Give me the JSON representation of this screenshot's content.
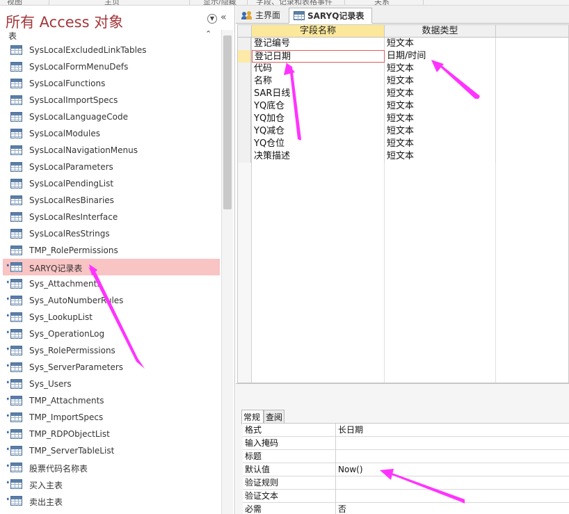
{
  "ribbon": {
    "items": [
      "视图",
      "主页",
      "显示/隐藏",
      "字段、记录和表格事件",
      "关系"
    ]
  },
  "nav_pane": {
    "title": "所有 Access 对象",
    "group_label": "表",
    "items": [
      {
        "label": "SysLocalExcludedLinkTables",
        "linked": false,
        "selected": false
      },
      {
        "label": "SysLocalFormMenuDefs",
        "linked": false,
        "selected": false
      },
      {
        "label": "SysLocalFunctions",
        "linked": false,
        "selected": false
      },
      {
        "label": "SysLocalImportSpecs",
        "linked": false,
        "selected": false
      },
      {
        "label": "SysLocalLanguageCode",
        "linked": false,
        "selected": false
      },
      {
        "label": "SysLocalModules",
        "linked": false,
        "selected": false
      },
      {
        "label": "SysLocalNavigationMenus",
        "linked": false,
        "selected": false
      },
      {
        "label": "SysLocalParameters",
        "linked": false,
        "selected": false
      },
      {
        "label": "SysLocalPendingList",
        "linked": false,
        "selected": false
      },
      {
        "label": "SysLocalResBinaries",
        "linked": false,
        "selected": false
      },
      {
        "label": "SysLocalResInterface",
        "linked": false,
        "selected": false
      },
      {
        "label": "SysLocalResStrings",
        "linked": false,
        "selected": false
      },
      {
        "label": "TMP_RolePermissions",
        "linked": false,
        "selected": false
      },
      {
        "label": "SARYQ记录表",
        "linked": true,
        "selected": true
      },
      {
        "label": "Sys_Attachments",
        "linked": true,
        "selected": false
      },
      {
        "label": "Sys_AutoNumberRules",
        "linked": true,
        "selected": false
      },
      {
        "label": "Sys_LookupList",
        "linked": true,
        "selected": false
      },
      {
        "label": "Sys_OperationLog",
        "linked": true,
        "selected": false
      },
      {
        "label": "Sys_RolePermissions",
        "linked": true,
        "selected": false
      },
      {
        "label": "Sys_ServerParameters",
        "linked": true,
        "selected": false
      },
      {
        "label": "Sys_Users",
        "linked": true,
        "selected": false
      },
      {
        "label": "TMP_Attachments",
        "linked": true,
        "selected": false
      },
      {
        "label": "TMP_ImportSpecs",
        "linked": true,
        "selected": false
      },
      {
        "label": "TMP_RDPObjectList",
        "linked": true,
        "selected": false
      },
      {
        "label": "TMP_ServerTableList",
        "linked": true,
        "selected": false
      },
      {
        "label": "股票代码名称表",
        "linked": true,
        "selected": false
      },
      {
        "label": "买入主表",
        "linked": true,
        "selected": false
      },
      {
        "label": "卖出主表",
        "linked": true,
        "selected": false
      }
    ]
  },
  "tabs": [
    {
      "label": "主界面",
      "active": false,
      "icon": "people-icon"
    },
    {
      "label": "SARYQ记录表",
      "active": true,
      "icon": "table-icon"
    }
  ],
  "design_grid": {
    "headers": {
      "field_name": "字段名称",
      "data_type": "数据类型"
    },
    "rows": [
      {
        "field": "登记编号",
        "type": "短文本"
      },
      {
        "field": "登记日期",
        "type": "日期/时间"
      },
      {
        "field": "代码",
        "type": "短文本"
      },
      {
        "field": "名称",
        "type": "短文本"
      },
      {
        "field": "SAR日线",
        "type": "短文本"
      },
      {
        "field": "YQ底仓",
        "type": "短文本"
      },
      {
        "field": "YQ加仓",
        "type": "短文本"
      },
      {
        "field": "YQ减仓",
        "type": "短文本"
      },
      {
        "field": "YQ仓位",
        "type": "短文本"
      },
      {
        "field": "决策描述",
        "type": "短文本"
      }
    ],
    "current_row": 1
  },
  "properties": {
    "tabs": [
      "常规",
      "查阅"
    ],
    "rows": [
      {
        "name": "格式",
        "value": "长日期"
      },
      {
        "name": "输入掩码",
        "value": ""
      },
      {
        "name": "标题",
        "value": ""
      },
      {
        "name": "默认值",
        "value": "Now()"
      },
      {
        "name": "验证规则",
        "value": ""
      },
      {
        "name": "验证文本",
        "value": ""
      },
      {
        "name": "必需",
        "value": "否"
      }
    ]
  },
  "colors": {
    "title_red": "#a4373a",
    "selected_row": "#f9c4c4",
    "annotation_magenta": "#ff33ff",
    "grid_header_highlight": "#fce89a"
  }
}
